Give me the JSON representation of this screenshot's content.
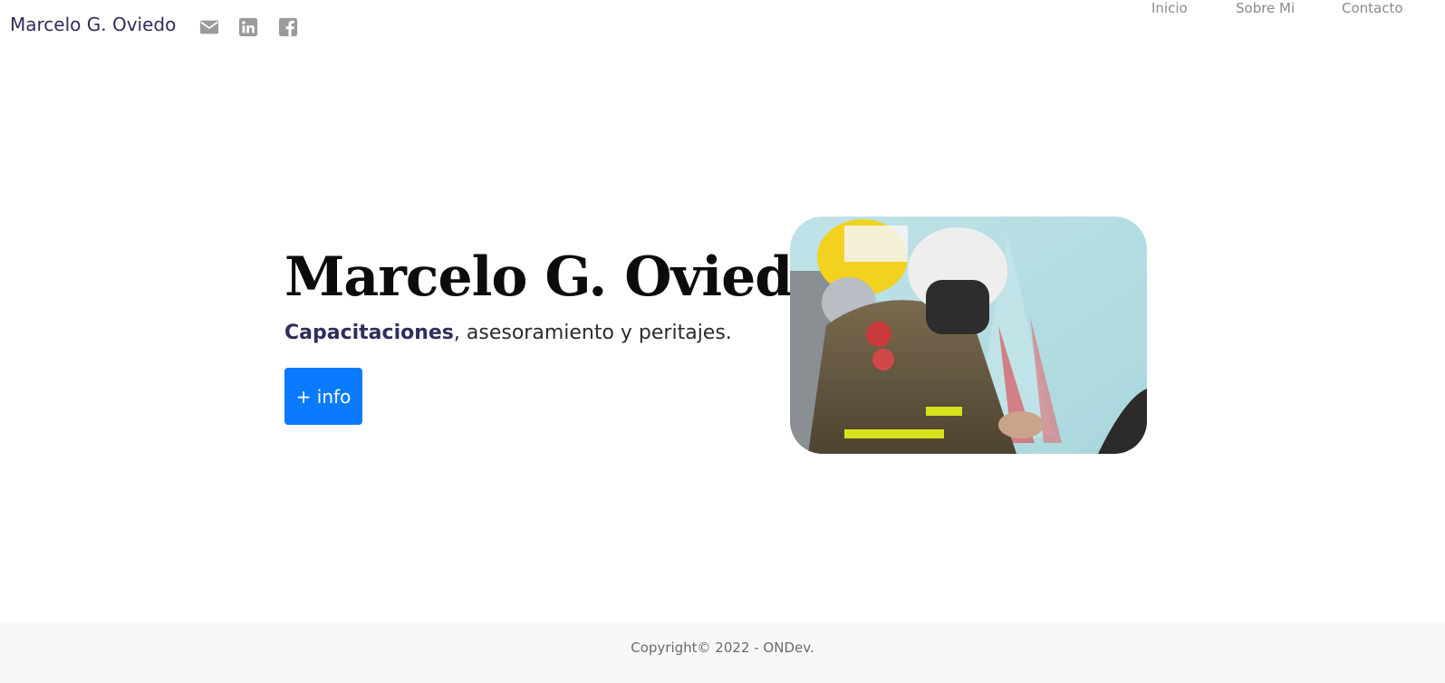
{
  "navbar": {
    "brand": "Marcelo G. Oviedo",
    "social": [
      {
        "icon": "mail-icon"
      },
      {
        "icon": "linkedin-icon"
      },
      {
        "icon": "facebook-icon"
      }
    ],
    "links": [
      {
        "label": "Inicio"
      },
      {
        "label": "Sobre Mi"
      },
      {
        "label": "Contacto"
      }
    ]
  },
  "hero": {
    "title": "Marcelo G. Oviedo",
    "subtitle_strong": "Capacitaciones",
    "subtitle_rest": ", asesoramiento y peritajes.",
    "button_label": "+ info"
  },
  "footer": {
    "copyright": "Copyright© 2022 - ONDev."
  },
  "colors": {
    "brand": "#2f2d5c",
    "accent": "#0a7bff",
    "nav_link": "#8a8a8a",
    "footer_bg": "#f8f8f8"
  }
}
